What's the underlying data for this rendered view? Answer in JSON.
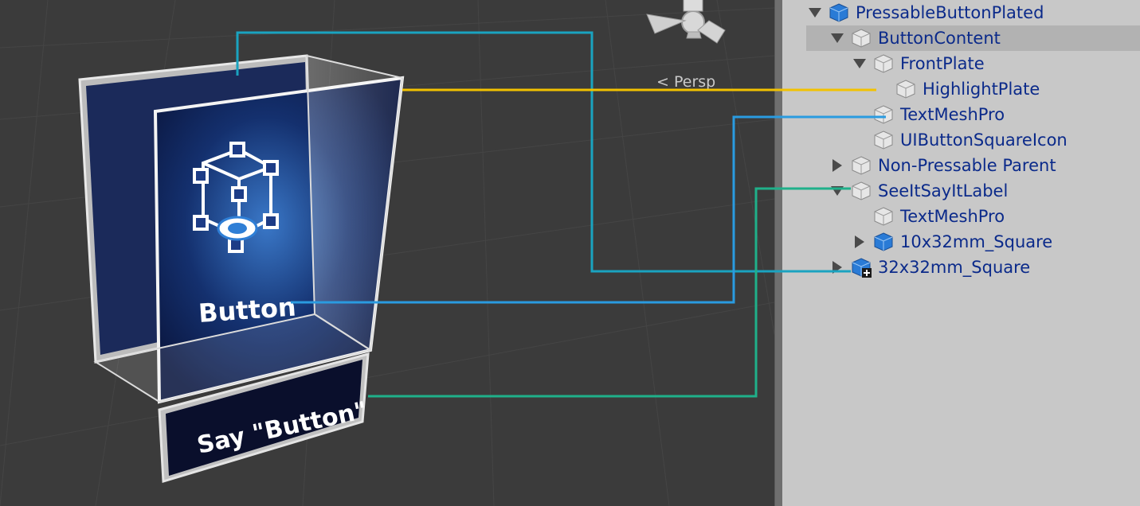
{
  "scene": {
    "persp_label": "Persp",
    "button_text": "Button",
    "label_text": "Say \"Button\""
  },
  "hierarchy": {
    "items": [
      {
        "label": "PressableButtonPlated",
        "icon": "prefab-cube-icon",
        "expand": "down"
      },
      {
        "label": "ButtonContent",
        "icon": "cube-icon",
        "expand": "down",
        "selected": true
      },
      {
        "label": "FrontPlate",
        "icon": "cube-icon",
        "expand": "down"
      },
      {
        "label": "HighlightPlate",
        "icon": "cube-icon",
        "expand": "none"
      },
      {
        "label": "TextMeshPro",
        "icon": "cube-icon",
        "expand": "none"
      },
      {
        "label": "UIButtonSquareIcon",
        "icon": "cube-icon",
        "expand": "none"
      },
      {
        "label": "Non-Pressable Parent",
        "icon": "cube-icon",
        "expand": "right"
      },
      {
        "label": "SeeItSayItLabel",
        "icon": "cube-icon",
        "expand": "down"
      },
      {
        "label": "TextMeshPro",
        "icon": "cube-icon",
        "expand": "none"
      },
      {
        "label": "10x32mm_Square",
        "icon": "prefab-cube-icon",
        "expand": "right"
      },
      {
        "label": "32x32mm_Square",
        "icon": "prefab-add-cube-icon",
        "expand": "right"
      }
    ]
  },
  "colors": {
    "callout_teal_blue": "#1aa3c0",
    "callout_yellow": "#f2c200",
    "callout_blue": "#2a9be0",
    "callout_green": "#1fb08a",
    "tree_text": "#0b2a8a"
  }
}
